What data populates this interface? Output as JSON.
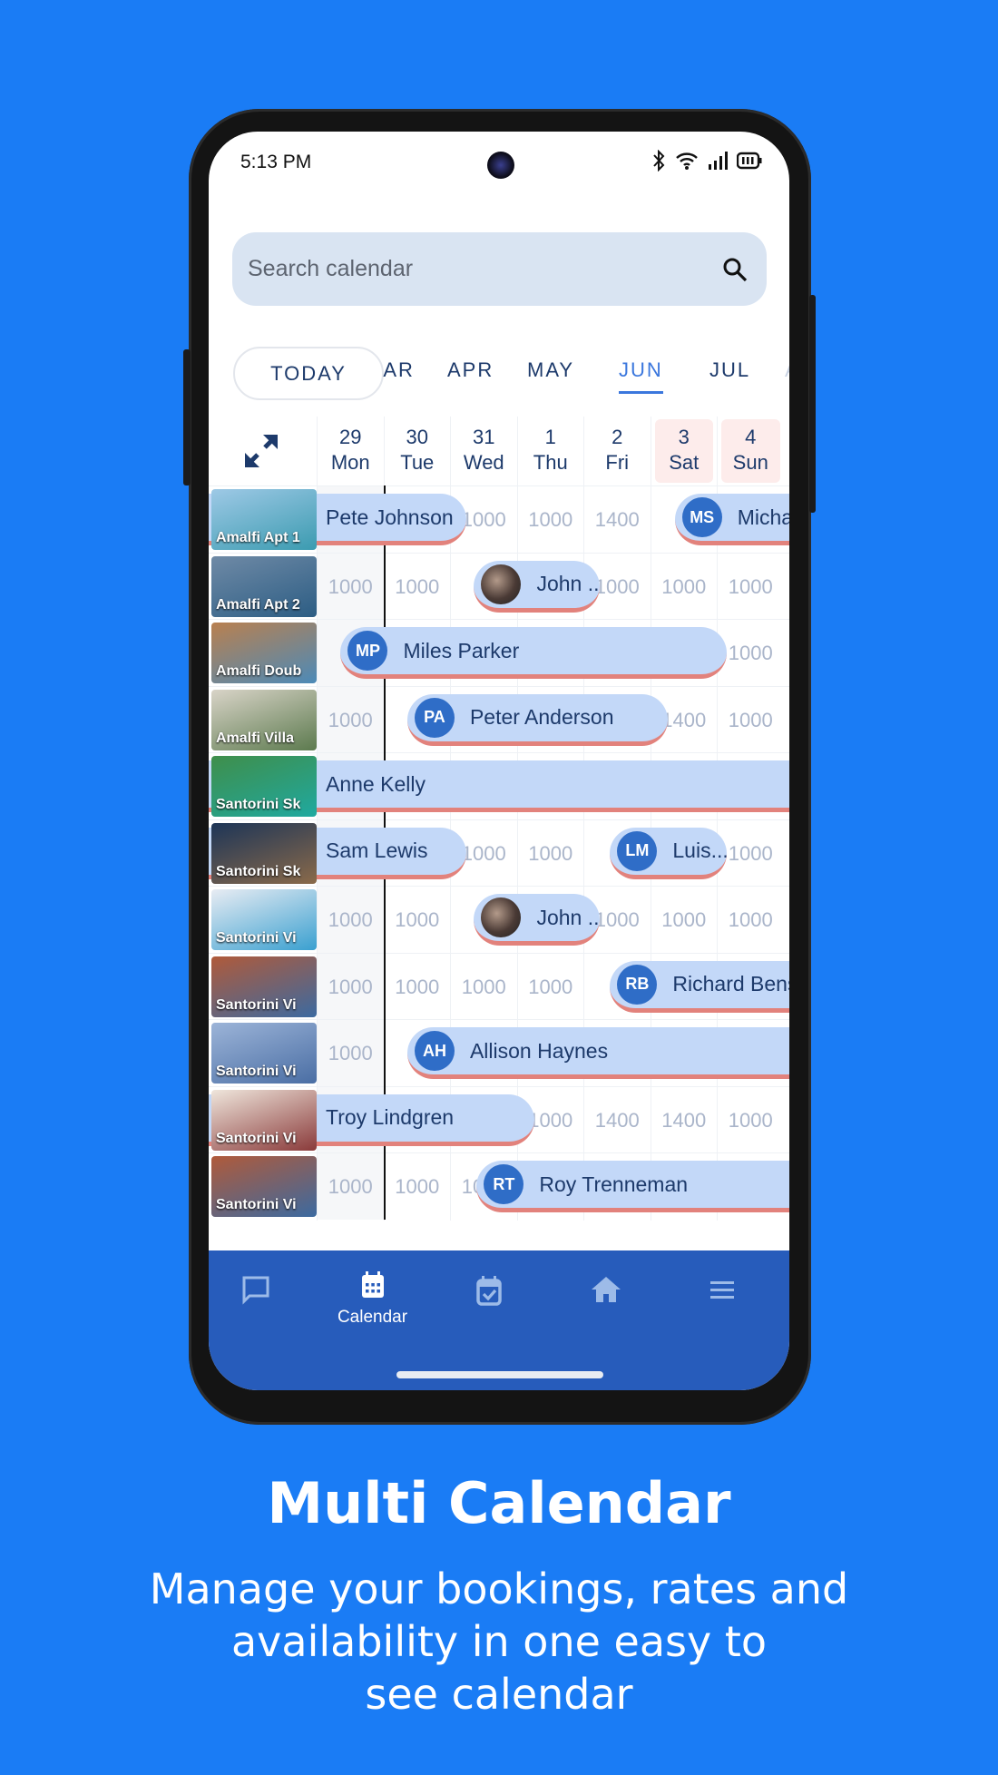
{
  "status_bar": {
    "time": "5:13 PM",
    "icons": [
      "bluetooth-icon",
      "wifi-icon",
      "signal-icon",
      "battery-icon"
    ]
  },
  "search": {
    "placeholder": "Search calendar",
    "value": ""
  },
  "today_button": "TODAY",
  "months": [
    {
      "label": "MAR",
      "visible_text": "‧R"
    },
    {
      "label": "APR"
    },
    {
      "label": "MAY"
    },
    {
      "label": "JUN",
      "active": true
    },
    {
      "label": "JUL"
    },
    {
      "label": "AU",
      "faded": true
    }
  ],
  "days": [
    {
      "num": "29",
      "dow": "Mon",
      "weekend": false
    },
    {
      "num": "30",
      "dow": "Tue",
      "weekend": false
    },
    {
      "num": "31",
      "dow": "Wed",
      "weekend": false
    },
    {
      "num": "1",
      "dow": "Thu",
      "weekend": false
    },
    {
      "num": "2",
      "dow": "Fri",
      "weekend": false
    },
    {
      "num": "3",
      "dow": "Sat",
      "weekend": true
    },
    {
      "num": "4",
      "dow": "Sun",
      "weekend": true
    }
  ],
  "properties": [
    {
      "name": "Amalfi Apt 1",
      "rates": [
        null,
        null,
        "1000",
        "1000",
        "1400",
        null,
        null
      ],
      "bookings": [
        {
          "guest": "Pete Johnson",
          "initials": ""
        },
        {
          "guest": "Micha",
          "initials": "MS"
        }
      ]
    },
    {
      "name": "Amalfi Apt 2",
      "rates": [
        "1000",
        "1000",
        null,
        null,
        "1000",
        "1000",
        "1000"
      ],
      "bookings": [
        {
          "guest": "John ...",
          "initials": "",
          "photo": true
        }
      ]
    },
    {
      "name": "Amalfi Doub",
      "rates": [
        null,
        null,
        null,
        null,
        null,
        null,
        "1000"
      ],
      "bookings": [
        {
          "guest": "Miles Parker",
          "initials": "MP"
        }
      ]
    },
    {
      "name": "Amalfi Villa",
      "rates": [
        "1000",
        null,
        null,
        null,
        null,
        "1400",
        "1000"
      ],
      "bookings": [
        {
          "guest": "Peter Anderson",
          "initials": "PA"
        }
      ]
    },
    {
      "name": "Santorini Sk",
      "rates": [
        null,
        null,
        null,
        null,
        null,
        null,
        null
      ],
      "bookings": [
        {
          "guest": "Anne Kelly",
          "initials": ""
        }
      ]
    },
    {
      "name": "Santorini Sk",
      "rates": [
        null,
        null,
        "1000",
        "1000",
        null,
        null,
        "1000"
      ],
      "bookings": [
        {
          "guest": "Sam Lewis",
          "initials": ""
        },
        {
          "guest": "Luis...",
          "initials": "LM"
        }
      ]
    },
    {
      "name": "Santorini Vi",
      "rates": [
        "1000",
        "1000",
        null,
        null,
        "1000",
        "1000",
        "1000"
      ],
      "bookings": [
        {
          "guest": "John ...",
          "initials": "",
          "photo": true
        }
      ]
    },
    {
      "name": "Santorini Vi",
      "rates": [
        "1000",
        "1000",
        "1000",
        "1000",
        null,
        null,
        null
      ],
      "bookings": [
        {
          "guest": "Richard Bens",
          "initials": "RB"
        }
      ]
    },
    {
      "name": "Santorini Vi",
      "rates": [
        "1000",
        null,
        null,
        null,
        null,
        null,
        null
      ],
      "bookings": [
        {
          "guest": "Allison Haynes",
          "initials": "AH"
        }
      ]
    },
    {
      "name": "Santorini Vi",
      "rates": [
        null,
        null,
        null,
        "1000",
        "1400",
        "1400",
        "1000"
      ],
      "bookings": [
        {
          "guest": "Troy Lindgren",
          "initials": ""
        }
      ]
    },
    {
      "name": "Santorini Vi",
      "rates": [
        "1000",
        "1000",
        "1000",
        null,
        null,
        null,
        null
      ],
      "bookings": [
        {
          "guest": "Roy Trenneman",
          "initials": "RT"
        }
      ]
    }
  ],
  "nav": [
    {
      "icon": "chat-icon",
      "label": ""
    },
    {
      "icon": "calendar-icon",
      "label": "Calendar",
      "active": true
    },
    {
      "icon": "calendar-check-icon",
      "label": ""
    },
    {
      "icon": "home-icon",
      "label": ""
    },
    {
      "icon": "menu-icon",
      "label": ""
    }
  ],
  "colors": {
    "background": "#1a7cf5",
    "nav": "#275cbb",
    "booking": "#c3d8f8",
    "booking_border": "#e2827c",
    "avatar": "#2f6dc7"
  },
  "promo": {
    "title": "Multi Calendar",
    "subtitle_lines": [
      "Manage your bookings, rates and",
      "availability in one easy to",
      "see calendar"
    ]
  }
}
